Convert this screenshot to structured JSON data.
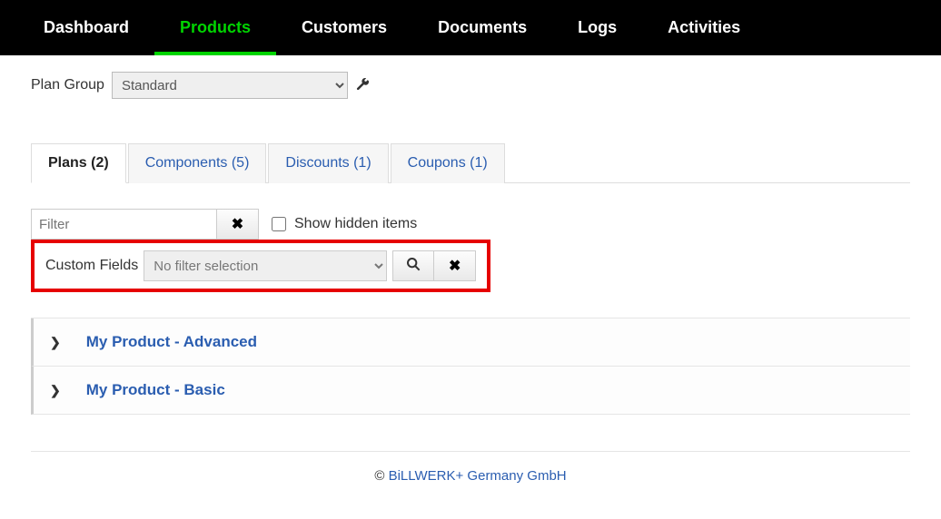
{
  "nav": {
    "items": [
      {
        "label": "Dashboard",
        "active": false
      },
      {
        "label": "Products",
        "active": true
      },
      {
        "label": "Customers",
        "active": false
      },
      {
        "label": "Documents",
        "active": false
      },
      {
        "label": "Logs",
        "active": false
      },
      {
        "label": "Activities",
        "active": false
      }
    ]
  },
  "planGroup": {
    "label": "Plan Group",
    "selected": "Standard"
  },
  "tabs": [
    {
      "label": "Plans (2)",
      "active": true
    },
    {
      "label": "Components (5)",
      "active": false
    },
    {
      "label": "Discounts (1)",
      "active": false
    },
    {
      "label": "Coupons (1)",
      "active": false
    }
  ],
  "filter": {
    "placeholder": "Filter",
    "value": "",
    "showHiddenLabel": "Show hidden items",
    "showHiddenChecked": false
  },
  "customFields": {
    "label": "Custom Fields",
    "placeholder": "No filter selection"
  },
  "plans": [
    {
      "title": "My Product - Advanced"
    },
    {
      "title": "My Product - Basic"
    }
  ],
  "footer": {
    "copyright": "©",
    "link": "BiLLWERK+ Germany GmbH"
  }
}
